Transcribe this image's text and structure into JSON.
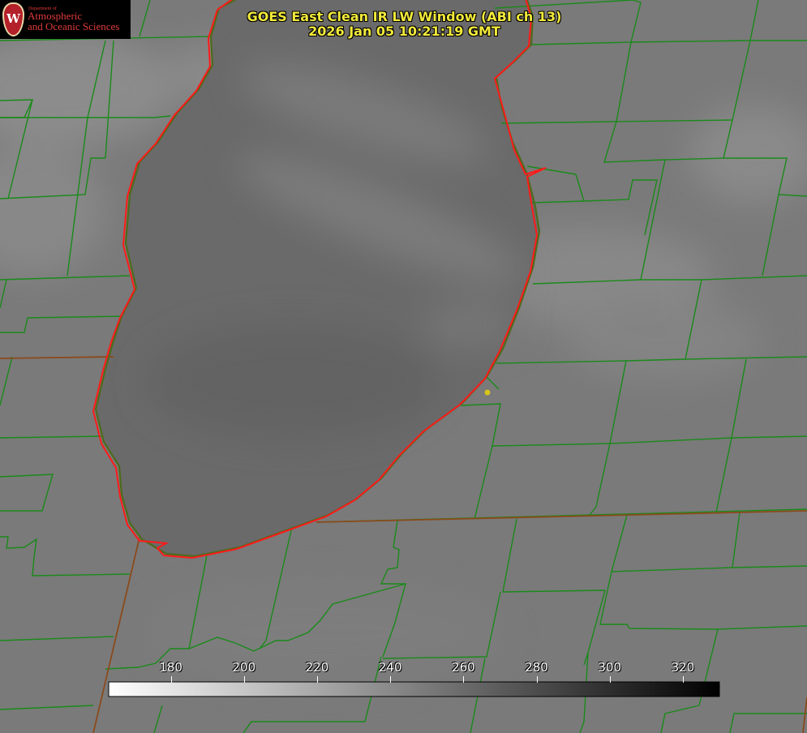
{
  "title": {
    "line1": "GOES East Clean IR LW Window (ABI ch 13)",
    "line2": "2026 Jan 05 10:21:19 GMT"
  },
  "logo": {
    "department": "Department of",
    "line1": "Atmospheric",
    "line2": "and Oceanic Sciences",
    "seal_letter": "W"
  },
  "colorbar": {
    "ticks": [
      "180",
      "200",
      "220",
      "240",
      "260",
      "280",
      "300",
      "320"
    ],
    "tick_values": [
      180,
      200,
      220,
      240,
      260,
      280,
      300,
      320
    ],
    "range": [
      163,
      330
    ],
    "colormap": "white (cold) to black (warm)"
  },
  "colors": {
    "county_lines": "#1a8a1a",
    "state_lines": "#a0522d",
    "lake_outline": "#ff1a1a",
    "title_text": "#f2ea3a",
    "marker": "#d4c51a"
  }
}
